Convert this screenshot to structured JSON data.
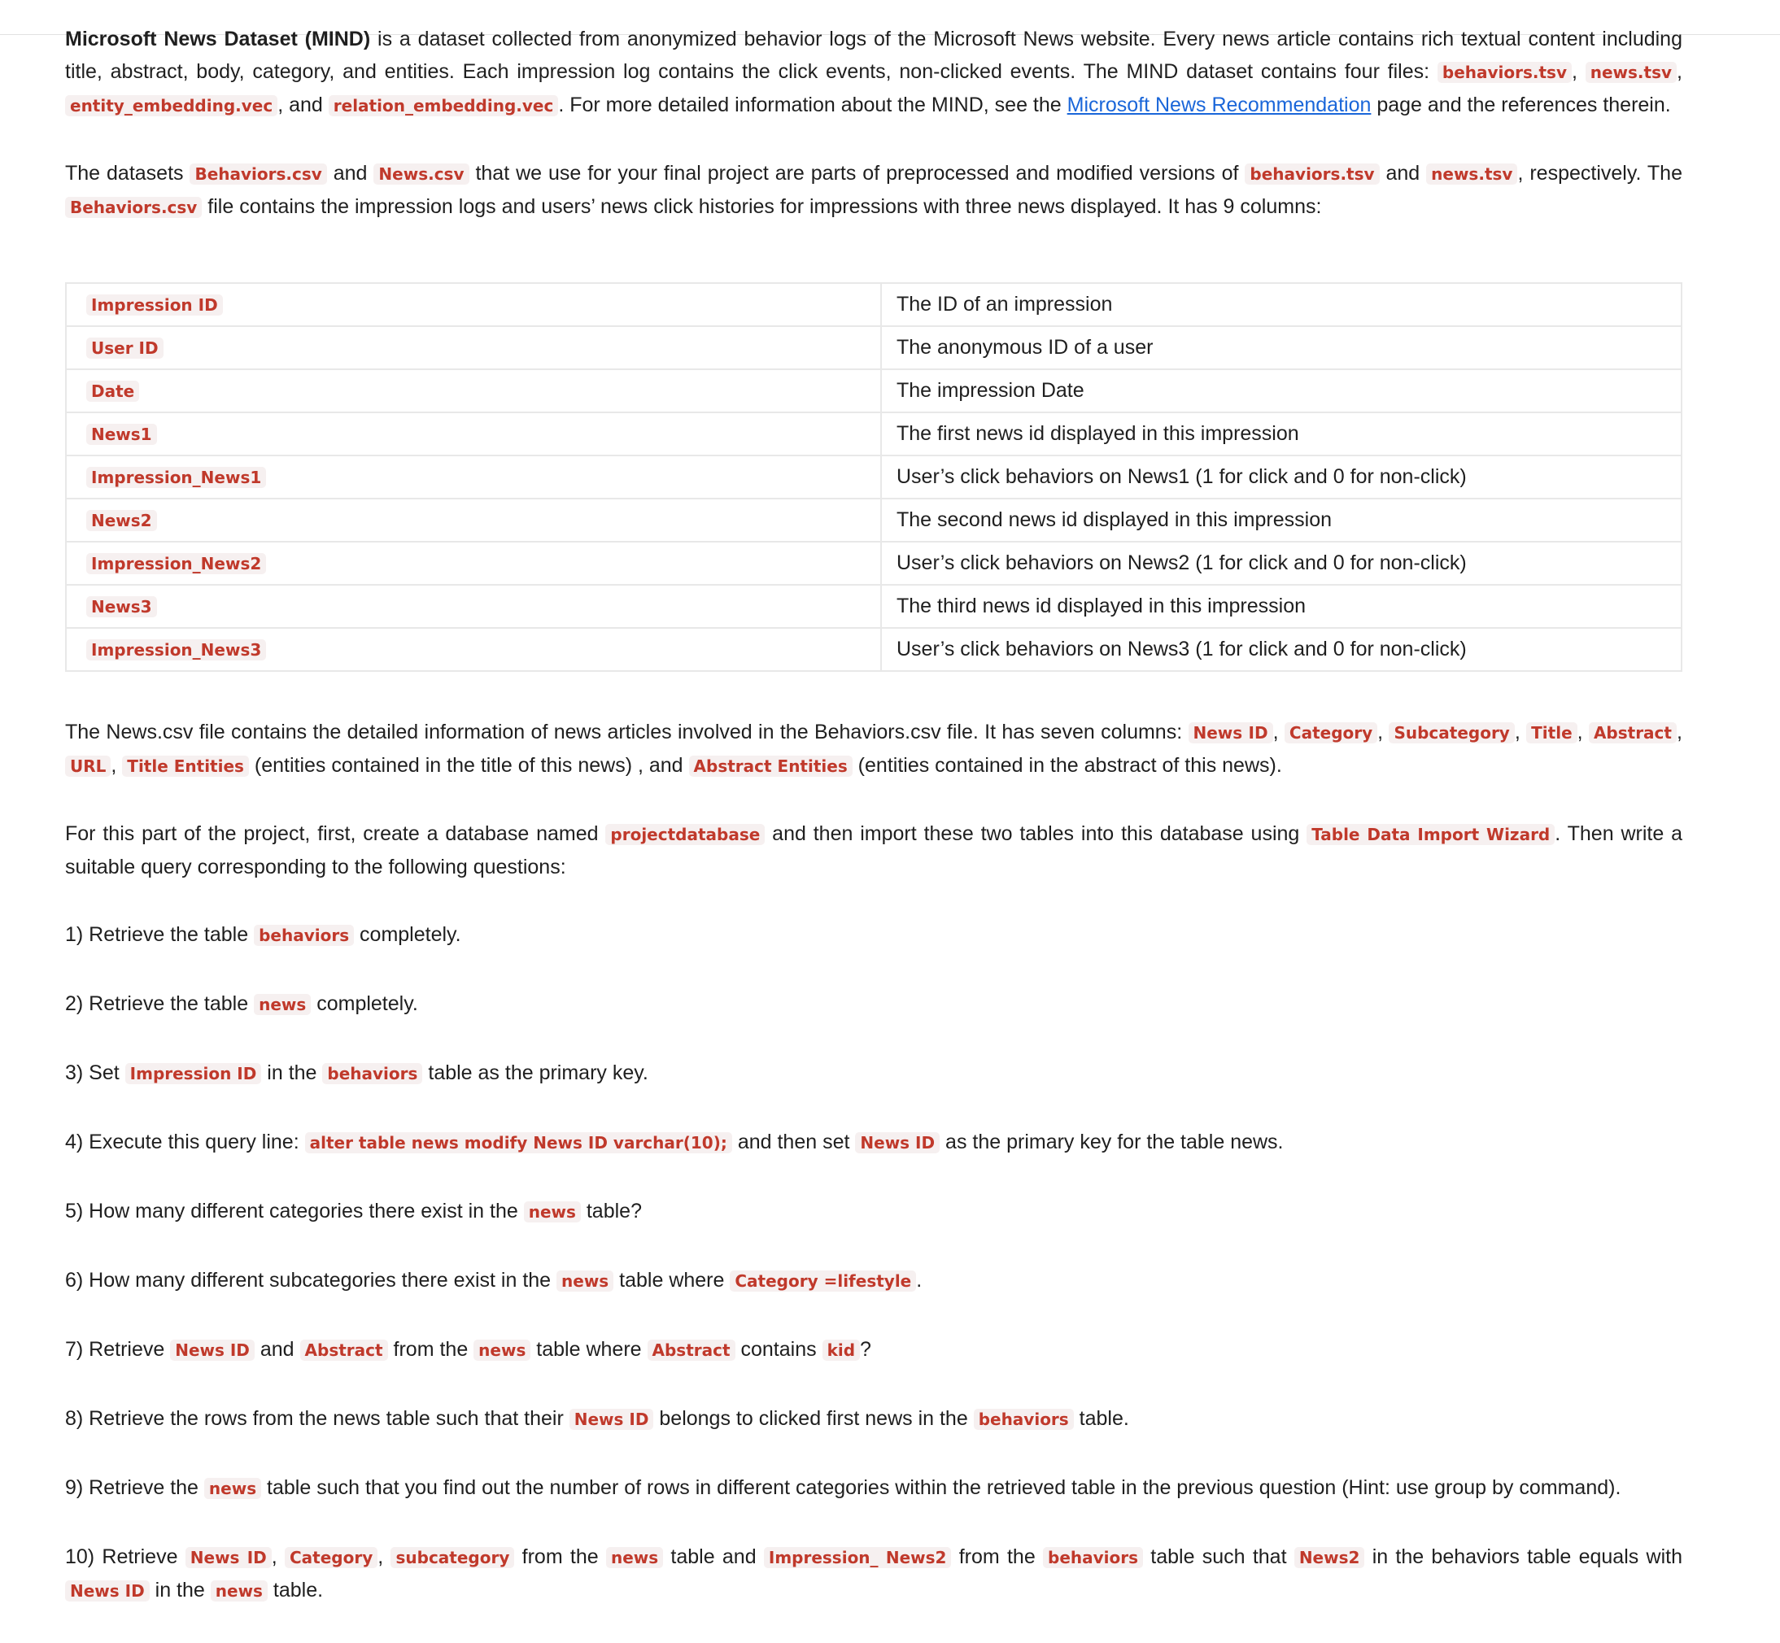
{
  "intro": {
    "title": "Microsoft News Dataset (MIND)",
    "t1": " is a dataset collected from anonymized behavior logs of the Microsoft News website. Every news article contains rich textual content including title, abstract, body, category, and entities. Each impression log contains the click events, non-clicked events. The MIND dataset contains four files: ",
    "c1": "behaviors.tsv",
    "t2": ", ",
    "c2": "news.tsv",
    "t3": ", ",
    "c3": "entity_embedding.vec",
    "t4": ", and ",
    "c4": "relation_embedding.vec",
    "t5": ". For more detailed information about the MIND, see the ",
    "link": "Microsoft News Recommendation",
    "t6": " page and the references therein."
  },
  "datasets": {
    "t1": "The datasets ",
    "c1": "Behaviors.csv",
    "t2": " and ",
    "c2": "News.csv",
    "t3": " that we use for your final project are parts of preprocessed and modified versions of ",
    "c3": "behaviors.tsv",
    "t4": " and ",
    "c4": "news.tsv",
    "t5": ", respectively. The ",
    "c5": "Behaviors.csv",
    "t6": " file contains the impression logs and users’ news click histories for impressions with three news displayed. It has 9 columns:"
  },
  "columns": [
    {
      "name": "Impression ID",
      "desc": "The ID of an impression"
    },
    {
      "name": "User ID",
      "desc": "The anonymous ID of a user"
    },
    {
      "name": "Date",
      "desc": "The impression Date"
    },
    {
      "name": "News1",
      "desc": "The first news id displayed in this impression"
    },
    {
      "name": "Impression_News1",
      "desc": "User’s click behaviors on News1 (1 for click and 0 for non-click)"
    },
    {
      "name": "News2",
      "desc": "The second news id displayed in this impression"
    },
    {
      "name": "Impression_News2",
      "desc": "User’s click behaviors on News2 (1 for click and 0 for non-click)"
    },
    {
      "name": "News3",
      "desc": "The third news id displayed in this impression"
    },
    {
      "name": "Impression_News3",
      "desc": "User’s click behaviors on News3 (1 for click and 0 for non-click)"
    }
  ],
  "news_para": {
    "t1": "The News.csv file contains the detailed information of news articles involved in the Behaviors.csv file. It has seven columns: ",
    "c1": "News ID",
    "t2": ", ",
    "c2": "Category",
    "t3": ", ",
    "c3": "Subcategory",
    "t4": ", ",
    "c4": "Title",
    "t5": ", ",
    "c5": "Abstract",
    "t6": ", ",
    "c6": "URL",
    "t7": ", ",
    "c7": "Title Entities",
    "t8": " (entities contained in the title of this news) , and ",
    "c8": "Abstract Entities",
    "t9": " (entities contained in the abstract of this news)."
  },
  "task_para": {
    "t1": "For this part of the project, first, create a database named ",
    "c1": "projectdatabase",
    "t2": " and then import these two tables into this database using ",
    "c2": "Table Data Import Wizard",
    "t3": ". Then write a suitable query corresponding to the following questions:"
  },
  "q": [
    {
      "t1": "1) Retrieve the table ",
      "c1": "behaviors",
      "t2": " completely."
    },
    {
      "t1": "2) Retrieve the table ",
      "c1": "news",
      "t2": " completely."
    },
    {
      "t1": "3) Set ",
      "c1": "Impression ID",
      "t2": " in the ",
      "c2": "behaviors",
      "t3": " table as the primary key."
    },
    {
      "t1": "4) Execute this query line: ",
      "c1": "alter table news modify News ID varchar(10);",
      "t2": " and then set ",
      "c2": "News ID",
      "t3": " as the primary key for the table news."
    },
    {
      "t1": "5) How many different categories there exist in the ",
      "c1": "news",
      "t2": " table?"
    },
    {
      "t1": "6) How many different subcategories there exist in the ",
      "c1": "news",
      "t2": " table where ",
      "c2": "Category =lifestyle",
      "t3": "."
    },
    {
      "t1": "7) Retrieve ",
      "c1": "News ID",
      "t2": " and ",
      "c2": "Abstract",
      "t3": " from the ",
      "c3": "news",
      "t4": " table where ",
      "c4": "Abstract",
      "t5": " contains ",
      "c5": "kid",
      "t6": "?"
    },
    {
      "t1": "8) Retrieve the rows from the news table such that their ",
      "c1": "News ID",
      "t2": " belongs to clicked first news in the ",
      "c2": "behaviors",
      "t3": " table."
    },
    {
      "t1": "9) Retrieve the ",
      "c1": "news",
      "t2": " table such that you find out the number of rows in different categories within the retrieved table in the previous question (Hint: use group by command)."
    },
    {
      "t1": "10) Retrieve ",
      "c1": "News ID",
      "t2": ", ",
      "c2": "Category",
      "t3": ", ",
      "c3": "subcategory",
      "t4": " from the ",
      "c4": "news",
      "t5": " table and ",
      "c5": "Impression_ News2",
      "t6": " from the ",
      "c6": "behaviors",
      "t7": " table such that ",
      "c7": "News2",
      "t8": " in the behaviors table equals with ",
      "c8": "News ID",
      "t9": " in the ",
      "c9": "news",
      "t10": " table."
    }
  ]
}
